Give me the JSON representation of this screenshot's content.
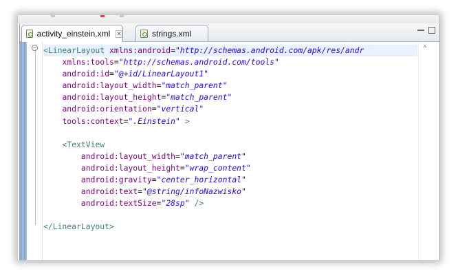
{
  "tabs": [
    {
      "label": "activity_einstein.xml",
      "active": true,
      "close_icon": "close-icon"
    },
    {
      "label": "strings.xml",
      "active": false
    }
  ],
  "colors": {
    "tag": "#3f7f7f",
    "attribute": "#7f007f",
    "value": "#2a00ff",
    "current_line": "#e8f2fe"
  },
  "code_lines": [
    {
      "indent": "",
      "tokens": [
        {
          "t": "tag",
          "v": "<LinearLayout "
        },
        {
          "t": "attr",
          "v": "xmlns:android"
        },
        {
          "t": "punct",
          "v": "="
        },
        {
          "t": "val",
          "v": "\"http://schemas.android.com/apk/res/andr"
        }
      ]
    },
    {
      "indent": "    ",
      "tokens": [
        {
          "t": "attr",
          "v": "xmlns:tools"
        },
        {
          "t": "punct",
          "v": "="
        },
        {
          "t": "val",
          "v": "\"http://schemas.android.com/tools\""
        }
      ]
    },
    {
      "indent": "    ",
      "tokens": [
        {
          "t": "attr",
          "v": "android:id"
        },
        {
          "t": "punct",
          "v": "="
        },
        {
          "t": "val",
          "v": "\"@+id/LinearLayout1\""
        }
      ]
    },
    {
      "indent": "    ",
      "tokens": [
        {
          "t": "attr",
          "v": "android:layout_width"
        },
        {
          "t": "punct",
          "v": "="
        },
        {
          "t": "val",
          "v": "\"match_parent\""
        }
      ]
    },
    {
      "indent": "    ",
      "tokens": [
        {
          "t": "attr",
          "v": "android:layout_height"
        },
        {
          "t": "punct",
          "v": "="
        },
        {
          "t": "val",
          "v": "\"match_parent\""
        }
      ]
    },
    {
      "indent": "    ",
      "tokens": [
        {
          "t": "attr",
          "v": "android:orientation"
        },
        {
          "t": "punct",
          "v": "="
        },
        {
          "t": "val",
          "v": "\"vertical\""
        }
      ]
    },
    {
      "indent": "    ",
      "tokens": [
        {
          "t": "attr",
          "v": "tools:context"
        },
        {
          "t": "punct",
          "v": "="
        },
        {
          "t": "val",
          "v": "\".Einstein\""
        },
        {
          "t": "tag",
          "v": " >"
        }
      ]
    },
    {
      "indent": "",
      "tokens": []
    },
    {
      "indent": "    ",
      "tokens": [
        {
          "t": "tag",
          "v": "<TextView"
        }
      ]
    },
    {
      "indent": "        ",
      "tokens": [
        {
          "t": "attr",
          "v": "android:layout_width"
        },
        {
          "t": "punct",
          "v": "="
        },
        {
          "t": "val",
          "v": "\"match_parent\""
        }
      ]
    },
    {
      "indent": "        ",
      "tokens": [
        {
          "t": "attr",
          "v": "android:layout_height"
        },
        {
          "t": "punct",
          "v": "="
        },
        {
          "t": "val",
          "v": "\"wrap_content\""
        }
      ]
    },
    {
      "indent": "        ",
      "tokens": [
        {
          "t": "attr",
          "v": "android:gravity"
        },
        {
          "t": "punct",
          "v": "="
        },
        {
          "t": "val",
          "v": "\"center_horizontal\""
        }
      ]
    },
    {
      "indent": "        ",
      "tokens": [
        {
          "t": "attr",
          "v": "android:text"
        },
        {
          "t": "punct",
          "v": "="
        },
        {
          "t": "val",
          "v": "\"@string/infoNazwisko\""
        }
      ]
    },
    {
      "indent": "        ",
      "tokens": [
        {
          "t": "attr",
          "v": "android:textSize"
        },
        {
          "t": "punct",
          "v": "="
        },
        {
          "t": "val",
          "v": "\"28sp\""
        },
        {
          "t": "tag",
          "v": " />"
        }
      ]
    },
    {
      "indent": "",
      "tokens": []
    },
    {
      "indent": "",
      "tokens": [
        {
          "t": "tag",
          "v": "</LinearLayout>"
        }
      ]
    }
  ]
}
